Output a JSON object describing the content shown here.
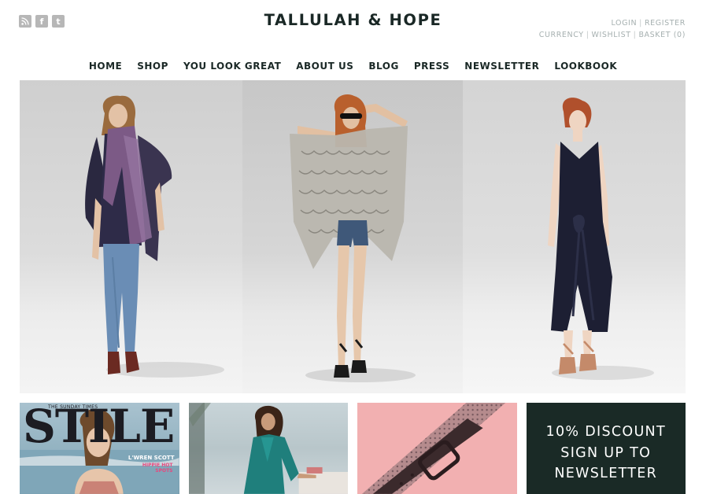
{
  "brand": {
    "logo": "TALLULAH & HOPE"
  },
  "social": [
    {
      "icon": "rss-icon",
      "glyph": ""
    },
    {
      "icon": "facebook-icon",
      "glyph": "f"
    },
    {
      "icon": "twitter-icon",
      "glyph": "t"
    }
  ],
  "account": {
    "login": "LOGIN",
    "register": "REGISTER",
    "currency": "CURRENCY",
    "wishlist": "WISHLIST",
    "basket": "BASKET (0)",
    "separator": "|"
  },
  "nav": {
    "items": [
      "HOME",
      "SHOP",
      "YOU LOOK GREAT",
      "ABOUT US",
      "BLOG",
      "PRESS",
      "NEWSLETTER",
      "LOOKBOOK"
    ]
  },
  "tiles": {
    "press": {
      "masthead": "STILE",
      "paper": "THE SUNDAY TIMES",
      "cover_name": "L'WREN SCOTT",
      "cover_line": "HIPPIE HOT SPOTS"
    },
    "promo": {
      "line1": "10% DISCOUNT",
      "line2": "SIGN UP TO",
      "line3": "NEWSLETTER"
    }
  },
  "colors": {
    "brand_dark": "#1a2826",
    "account_grey": "#a6b0b0",
    "promo_bg": "#1a2a26",
    "pink_tile": "#f2b0b1"
  }
}
